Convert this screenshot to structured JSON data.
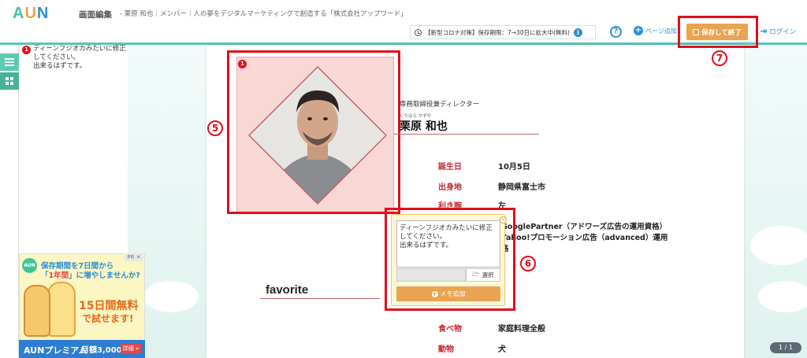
{
  "header": {
    "logo": "AUN",
    "title": "画面編集",
    "subtitle": "- 栗原 和也｜メンバー｜人の夢をデジタルマーケティングで創造する「株式会社アップワード」",
    "notice": "【新型コロナ対策】保存期限：7→30日に拡大中(無料)",
    "help": "?",
    "add_page": "ページ追加",
    "save": "保存して終了",
    "login": "ログイン"
  },
  "memo_list": {
    "badge": "1",
    "text": "ディーンフジオカみたいに修正してください。\n出来るはずです。"
  },
  "ad": {
    "pr": "PR ✕",
    "line1": "保存期間を7日間から",
    "line2_pre": "「",
    "line2_em": "1年間",
    "line2_post": "」に増やしませんか?",
    "free": "15日間無料",
    "try": "で試せます!",
    "brand": "AUNプレミアム",
    "price": "月額3,000円",
    "more": "詳細 »",
    "logo": "AUN"
  },
  "profile": {
    "photo_badge": "1",
    "role": "専務取締役兼ディレクター",
    "ruby": "くりはら かずや",
    "name": "栗原 和也",
    "rows": [
      {
        "label": "誕生日",
        "value": "10月5日"
      },
      {
        "label": "出身地",
        "value": "静岡県富士市"
      },
      {
        "label": "利き腕",
        "value": "左"
      }
    ],
    "qual_lines": [
      "GooglePartner（アドワーズ広告の運用資格）",
      "Yahoo!プロモーション広告（advanced）運用",
      "格"
    ],
    "favorite_title": "favorite",
    "fav_rows": [
      {
        "label": "食べ物",
        "value": "家庭料理全般"
      },
      {
        "label": "動物",
        "value": "犬"
      }
    ]
  },
  "memo_popup": {
    "text": "ディーンフジオカみたいに修正してください。\n出来るはずです。",
    "select": "選択",
    "add": "メモ追加",
    "close": "×"
  },
  "annotations": {
    "n5": "5",
    "n6": "6",
    "n7": "7"
  },
  "pager": "1 / 1",
  "colors": {
    "accent": "#55c6b8",
    "save": "#e9a452",
    "highlight": "#e30e1b",
    "label": "#c2282e"
  }
}
